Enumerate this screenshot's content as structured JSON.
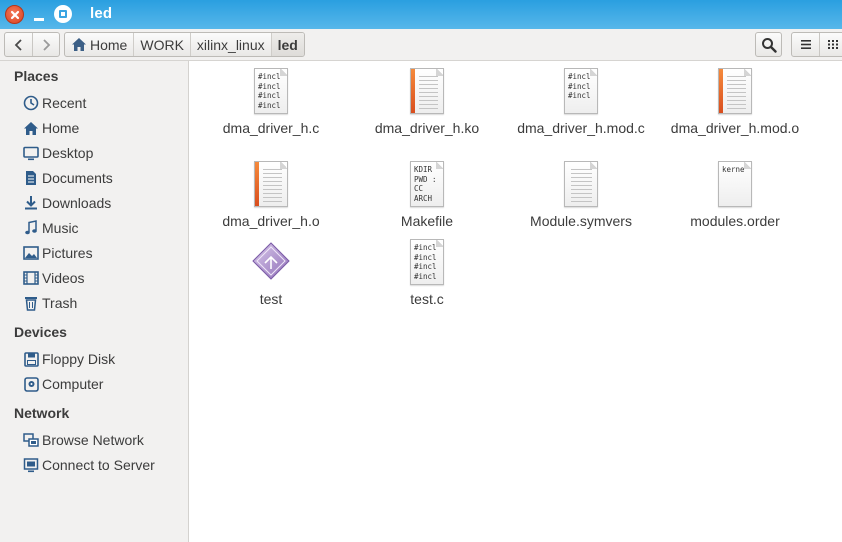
{
  "window": {
    "title": "led"
  },
  "toolbar": {
    "breadcrumbs": [
      {
        "label": "Home",
        "icon": "home-icon"
      },
      {
        "label": "WORK"
      },
      {
        "label": "xilinx_linux"
      },
      {
        "label": "led",
        "active": true
      }
    ]
  },
  "sidebar": {
    "sections": [
      {
        "title": "Places",
        "items": [
          {
            "label": "Recent",
            "icon": "clock-icon"
          },
          {
            "label": "Home",
            "icon": "home-icon"
          },
          {
            "label": "Desktop",
            "icon": "desktop-icon"
          },
          {
            "label": "Documents",
            "icon": "documents-icon"
          },
          {
            "label": "Downloads",
            "icon": "download-icon"
          },
          {
            "label": "Music",
            "icon": "music-icon"
          },
          {
            "label": "Pictures",
            "icon": "pictures-icon"
          },
          {
            "label": "Videos",
            "icon": "videos-icon"
          },
          {
            "label": "Trash",
            "icon": "trash-icon"
          }
        ]
      },
      {
        "title": "Devices",
        "items": [
          {
            "label": "Floppy Disk",
            "icon": "floppy-icon"
          },
          {
            "label": "Computer",
            "icon": "harddisk-icon"
          }
        ]
      },
      {
        "title": "Network",
        "items": [
          {
            "label": "Browse Network",
            "icon": "network-icon"
          },
          {
            "label": "Connect to Server",
            "icon": "server-icon"
          }
        ]
      }
    ]
  },
  "files": [
    {
      "name": "dma_driver_h.c",
      "icon": "c-source-icon",
      "preview": "#incl\n#incl\n#incl\n#incl"
    },
    {
      "name": "dma_driver_h.ko",
      "icon": "object-file-icon"
    },
    {
      "name": "dma_driver_h.mod.c",
      "icon": "c-source-icon",
      "preview": "#incl\n#incl\n#incl"
    },
    {
      "name": "dma_driver_h.mod.o",
      "icon": "object-file-icon"
    },
    {
      "name": "dma_driver_h.o",
      "icon": "object-file-icon"
    },
    {
      "name": "Makefile",
      "icon": "makefile-icon",
      "preview": "KDIR\nPWD :\nCC\nARCH"
    },
    {
      "name": "Module.symvers",
      "icon": "text-file-icon"
    },
    {
      "name": "modules.order",
      "icon": "text-file-icon",
      "preview": "kerne"
    },
    {
      "name": "test",
      "icon": "executable-icon"
    },
    {
      "name": "test.c",
      "icon": "c-source-icon",
      "preview": "#incl\n#incl\n#incl\n#incl"
    }
  ],
  "colors": {
    "titlebar": "#3aa8e4",
    "accent": "#1f6fb5",
    "close": "#e2532f"
  }
}
